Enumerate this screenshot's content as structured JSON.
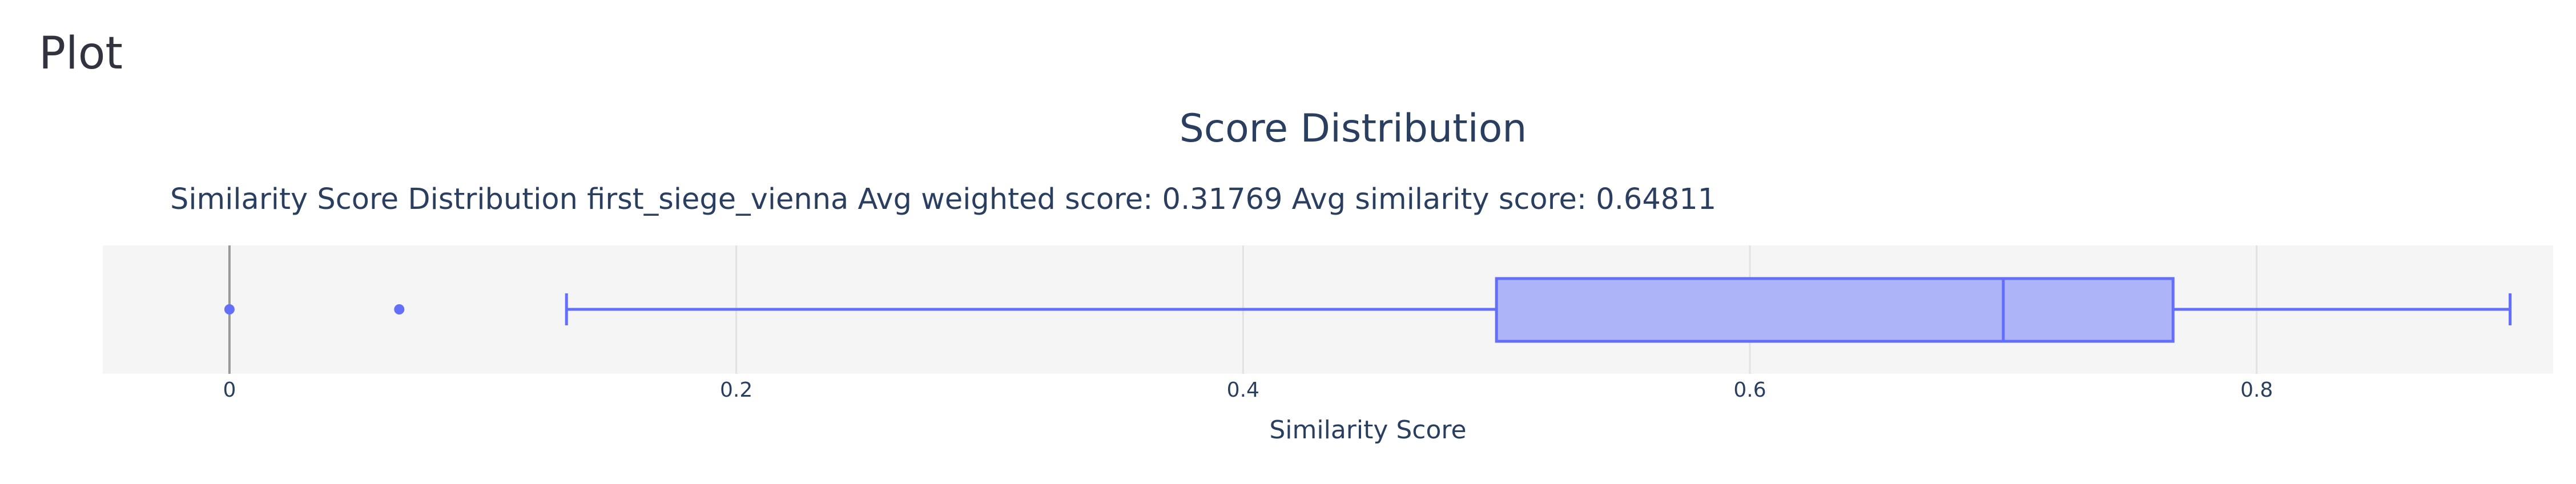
{
  "page": {
    "heading": "Plot"
  },
  "chart_data": {
    "type": "box",
    "title": "Score Distribution",
    "subtitle": "Similarity Score Distribution first_siege_vienna Avg weighted score: 0.31769  Avg similarity score: 0.64811",
    "xlabel": "Similarity Score",
    "ylabel": "",
    "orientation": "horizontal",
    "xlim": [
      -0.05,
      0.917
    ],
    "ticks": [
      0,
      0.2,
      0.4,
      0.6,
      0.8
    ],
    "tick_labels": [
      "0",
      "0.2",
      "0.4",
      "0.6",
      "0.8"
    ],
    "grid": true,
    "box": {
      "lower_fence": 0.133,
      "q1": 0.5,
      "median": 0.7,
      "q3": 0.767,
      "upper_fence": 0.9
    },
    "outliers": [
      0,
      0.067
    ],
    "colors": {
      "box_line": "#636efa",
      "box_fill": "#aab0f8",
      "plot_bg": "#f5f5f5",
      "grid": "#e2e2e2",
      "zero_line": "#999999",
      "text": "#2a3f5f"
    }
  }
}
